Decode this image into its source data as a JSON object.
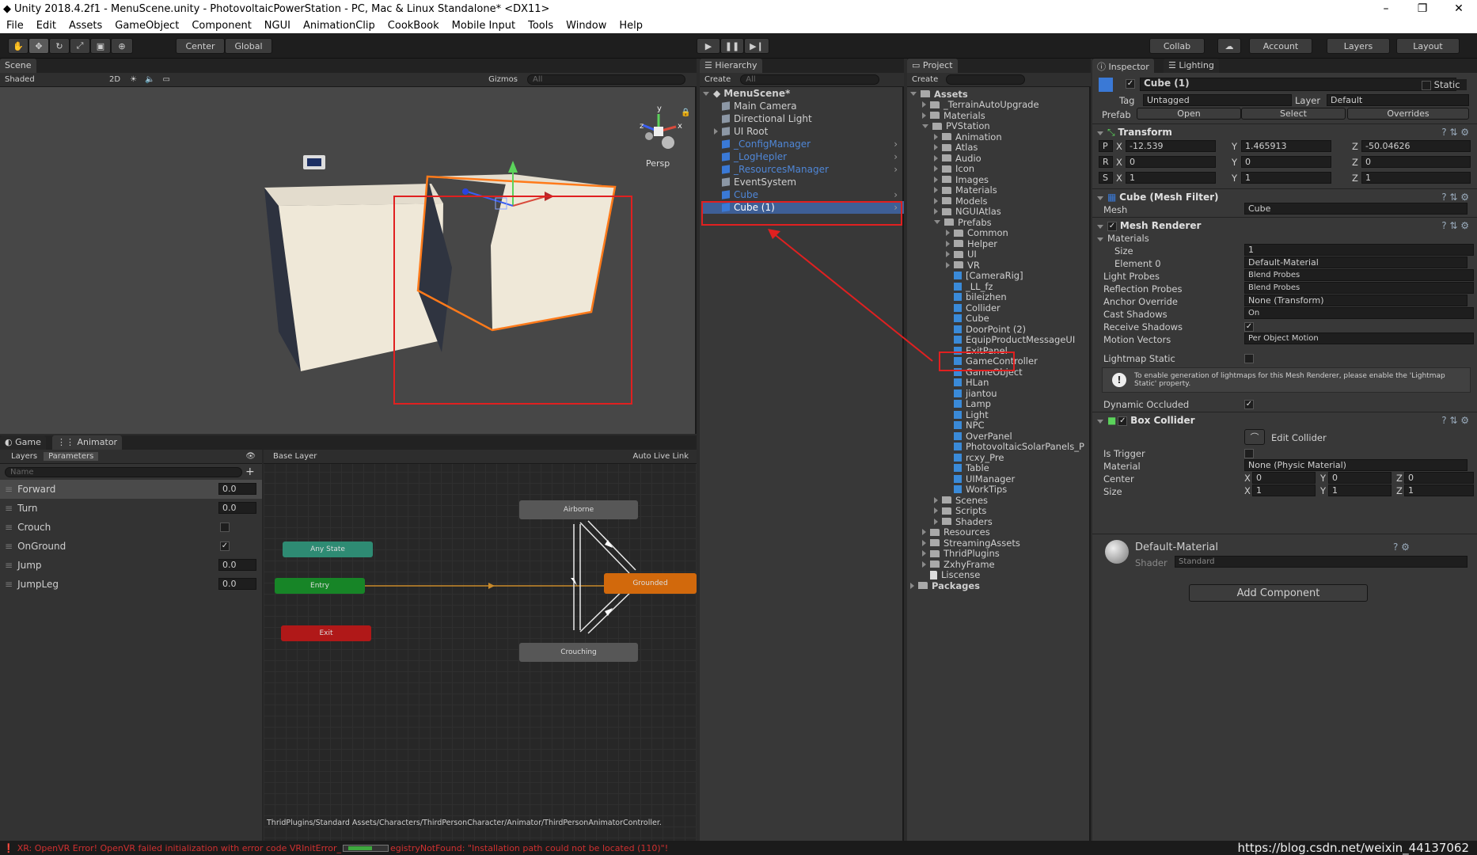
{
  "window": {
    "title": "Unity 2018.4.2f1 - MenuScene.unity - PhotovoltaicPowerStation - PC, Mac & Linux Standalone* <DX11>",
    "min": "–",
    "max": "❐",
    "close": "✕"
  },
  "menu": [
    "File",
    "Edit",
    "Assets",
    "GameObject",
    "Component",
    "NGUI",
    "AnimationClip",
    "CookBook",
    "Mobile Input",
    "Tools",
    "Window",
    "Help"
  ],
  "toolbar": {
    "center": "Center",
    "global": "Global",
    "collab": "Collab",
    "account": "Account",
    "layers": "Layers",
    "layout": "Layout"
  },
  "scene": {
    "tab": "Scene",
    "shading": "Shaded",
    "mode2d": "2D",
    "gizmos": "Gizmos",
    "search": "All",
    "persp": "Persp"
  },
  "game": {
    "tab_game": "Game",
    "tab_animator": "Animator"
  },
  "animator": {
    "layers_tab": "Layers",
    "params_tab": "Parameters",
    "name_placeholder": "Name",
    "base_layer": "Base Layer",
    "auto_live": "Auto Live Link",
    "params": [
      {
        "name": "Forward",
        "value": "0.0",
        "type": "float"
      },
      {
        "name": "Turn",
        "value": "0.0",
        "type": "float"
      },
      {
        "name": "Crouch",
        "value": "",
        "type": "bool",
        "checked": false
      },
      {
        "name": "OnGround",
        "value": "",
        "type": "bool",
        "checked": true
      },
      {
        "name": "Jump",
        "value": "0.0",
        "type": "float"
      },
      {
        "name": "JumpLeg",
        "value": "0.0",
        "type": "float"
      }
    ],
    "nodes": {
      "airborne": "Airborne",
      "any": "Any State",
      "entry": "Entry",
      "grounded": "Grounded",
      "exit": "Exit",
      "crouching": "Crouching"
    },
    "path": "ThridPlugins/Standard Assets/Characters/ThirdPersonCharacter/Animator/ThirdPersonAnimatorController."
  },
  "hierarchy": {
    "tab": "Hierarchy",
    "create": "Create",
    "search": "All",
    "scene": "MenuScene*",
    "items": [
      {
        "label": "Main Camera",
        "color": "n"
      },
      {
        "label": "Directional Light",
        "color": "n"
      },
      {
        "label": "UI Root",
        "color": "n",
        "arrow": true
      },
      {
        "label": "_ConfigManager",
        "color": "b",
        "more": true
      },
      {
        "label": "_LogHepler",
        "color": "b",
        "more": true
      },
      {
        "label": "_ResourcesManager",
        "color": "b",
        "more": true
      },
      {
        "label": "EventSystem",
        "color": "n"
      },
      {
        "label": "Cube",
        "color": "b",
        "more": true
      },
      {
        "label": "Cube (1)",
        "color": "s",
        "more": true
      }
    ]
  },
  "project": {
    "tab": "Project",
    "create": "Create",
    "tree": [
      {
        "label": "Assets",
        "d": 0,
        "t": "d",
        "k": "f",
        "bold": true
      },
      {
        "label": "_TerrainAutoUpgrade",
        "d": 1,
        "t": "r",
        "k": "f"
      },
      {
        "label": "Materials",
        "d": 1,
        "t": "r",
        "k": "f"
      },
      {
        "label": "PVStation",
        "d": 1,
        "t": "d",
        "k": "f"
      },
      {
        "label": "Animation",
        "d": 2,
        "t": "r",
        "k": "f"
      },
      {
        "label": "Atlas",
        "d": 2,
        "t": "r",
        "k": "f"
      },
      {
        "label": "Audio",
        "d": 2,
        "t": "r",
        "k": "f"
      },
      {
        "label": "Icon",
        "d": 2,
        "t": "r",
        "k": "f"
      },
      {
        "label": "Images",
        "d": 2,
        "t": "r",
        "k": "f"
      },
      {
        "label": "Materials",
        "d": 2,
        "t": "r",
        "k": "f"
      },
      {
        "label": "Models",
        "d": 2,
        "t": "r",
        "k": "f"
      },
      {
        "label": "NGUIAtlas",
        "d": 2,
        "t": "r",
        "k": "f"
      },
      {
        "label": "Prefabs",
        "d": 2,
        "t": "d",
        "k": "f"
      },
      {
        "label": "Common",
        "d": 3,
        "t": "r",
        "k": "f"
      },
      {
        "label": "Helper",
        "d": 3,
        "t": "r",
        "k": "f"
      },
      {
        "label": "UI",
        "d": 3,
        "t": "r",
        "k": "f"
      },
      {
        "label": "VR",
        "d": 3,
        "t": "r",
        "k": "f"
      },
      {
        "label": "[CameraRig]",
        "d": 3,
        "t": "n",
        "k": "p"
      },
      {
        "label": "_LL_fz",
        "d": 3,
        "t": "n",
        "k": "p"
      },
      {
        "label": "bileizhen",
        "d": 3,
        "t": "n",
        "k": "p"
      },
      {
        "label": "Collider",
        "d": 3,
        "t": "n",
        "k": "p"
      },
      {
        "label": "Cube",
        "d": 3,
        "t": "n",
        "k": "p"
      },
      {
        "label": "DoorPoint (2)",
        "d": 3,
        "t": "n",
        "k": "p"
      },
      {
        "label": "EquipProductMessageUI",
        "d": 3,
        "t": "n",
        "k": "p"
      },
      {
        "label": "ExitPanel",
        "d": 3,
        "t": "n",
        "k": "p"
      },
      {
        "label": "GameController",
        "d": 3,
        "t": "n",
        "k": "p"
      },
      {
        "label": "GameObject",
        "d": 3,
        "t": "n",
        "k": "p"
      },
      {
        "label": "HLan",
        "d": 3,
        "t": "n",
        "k": "p"
      },
      {
        "label": "jiantou",
        "d": 3,
        "t": "n",
        "k": "p"
      },
      {
        "label": "Lamp",
        "d": 3,
        "t": "n",
        "k": "p"
      },
      {
        "label": "Light",
        "d": 3,
        "t": "n",
        "k": "p"
      },
      {
        "label": "NPC",
        "d": 3,
        "t": "n",
        "k": "p"
      },
      {
        "label": "OverPanel",
        "d": 3,
        "t": "n",
        "k": "p"
      },
      {
        "label": "PhotovoltaicSolarPanels_P",
        "d": 3,
        "t": "n",
        "k": "p"
      },
      {
        "label": "rcxy_Pre",
        "d": 3,
        "t": "n",
        "k": "p"
      },
      {
        "label": "Table",
        "d": 3,
        "t": "n",
        "k": "p"
      },
      {
        "label": "UIManager",
        "d": 3,
        "t": "n",
        "k": "p"
      },
      {
        "label": "WorkTips",
        "d": 3,
        "t": "n",
        "k": "p"
      },
      {
        "label": "Scenes",
        "d": 2,
        "t": "r",
        "k": "f"
      },
      {
        "label": "Scripts",
        "d": 2,
        "t": "r",
        "k": "f"
      },
      {
        "label": "Shaders",
        "d": 2,
        "t": "r",
        "k": "f"
      },
      {
        "label": "Resources",
        "d": 1,
        "t": "r",
        "k": "f"
      },
      {
        "label": "StreamingAssets",
        "d": 1,
        "t": "r",
        "k": "f"
      },
      {
        "label": "ThridPlugins",
        "d": 1,
        "t": "r",
        "k": "f"
      },
      {
        "label": "ZxhyFrame",
        "d": 1,
        "t": "r",
        "k": "f"
      },
      {
        "label": "Liscense",
        "d": 1,
        "t": "n",
        "k": "x"
      },
      {
        "label": "Packages",
        "d": 0,
        "t": "r",
        "k": "f",
        "bold": true
      }
    ]
  },
  "inspector": {
    "tab": "Inspector",
    "lighting_tab": "Lighting",
    "name": "Cube (1)",
    "static": "Static",
    "tag_label": "Tag",
    "tag": "Untagged",
    "layer_label": "Layer",
    "layer": "Default",
    "prefab_label": "Prefab",
    "open": "Open",
    "select": "Select",
    "overrides": "Overrides",
    "transform": {
      "title": "Transform",
      "p": {
        "x": "-12.539",
        "y": "1.465913",
        "z": "-50.04626"
      },
      "r": {
        "x": "0",
        "y": "0",
        "z": "0"
      },
      "s": {
        "x": "1",
        "y": "1",
        "z": "1"
      }
    },
    "meshfilter": {
      "title": "Cube (Mesh Filter)",
      "mesh_label": "Mesh",
      "mesh": "Cube"
    },
    "meshrenderer": {
      "title": "Mesh Renderer",
      "materials": "Materials",
      "size_label": "Size",
      "size": "1",
      "el0_label": "Element 0",
      "el0": "Default-Material",
      "rows": [
        {
          "label": "Light Probes",
          "value": "Blend Probes"
        },
        {
          "label": "Reflection Probes",
          "value": "Blend Probes"
        },
        {
          "label": "Anchor Override",
          "value": "None (Transform)"
        },
        {
          "label": "Cast Shadows",
          "value": "On"
        }
      ],
      "receive": "Receive Shadows",
      "motion_label": "Motion Vectors",
      "motion": "Per Object Motion",
      "lightmap": "Lightmap Static",
      "note": "To enable generation of lightmaps for this Mesh Renderer, please enable the 'Lightmap Static' property.",
      "dyn": "Dynamic Occluded"
    },
    "boxcollider": {
      "title": "Box Collider",
      "edit": "Edit Collider",
      "trigger": "Is Trigger",
      "material_label": "Material",
      "material": "None (Physic Material)",
      "center_label": "Center",
      "center": {
        "x": "0",
        "y": "0",
        "z": "0"
      },
      "size_label": "Size",
      "size": {
        "x": "1",
        "y": "1",
        "z": "1"
      }
    },
    "material": {
      "name": "Default-Material",
      "shader_label": "Shader",
      "shader": "Standard"
    },
    "add": "Add Component"
  },
  "status": {
    "error": "XR: OpenVR Error! OpenVR failed initialization with error code VRInitError_",
    "error2": "egistryNotFound: \"Installation path could not be located (110)\"!",
    "watermark": "https://blog.csdn.net/weixin_44137062"
  }
}
